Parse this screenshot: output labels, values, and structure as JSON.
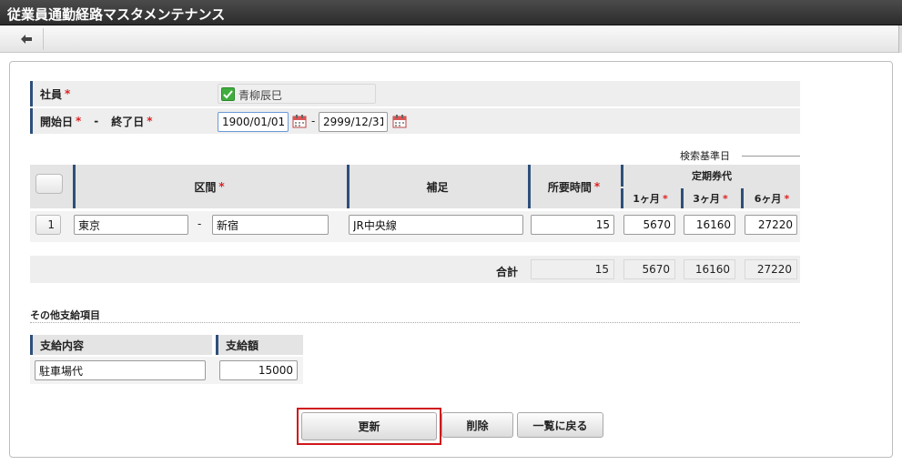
{
  "window": {
    "title": "従業員通勤経路マスタメンテナンス"
  },
  "toolbar": {
    "back_icon": "arrow-left-icon"
  },
  "employee": {
    "label": "社員",
    "required_mark": "*",
    "name": "青柳辰巳"
  },
  "period": {
    "start_label": "開始日",
    "separator": "-",
    "end_label": "終了日",
    "required_mark": "*",
    "start_value": "1900/01/01",
    "end_value": "2999/12/31",
    "range_separator": "-"
  },
  "search_base_date_label": "検索基準日",
  "route_table": {
    "headers": {
      "section": "区間",
      "note": "補足",
      "time": "所要時間",
      "commuter_pass": "定期券代",
      "one_month": "1ヶ月",
      "three_month": "3ヶ月",
      "six_month": "6ヶ月",
      "required_mark": "*"
    },
    "rows": [
      {
        "no": "1",
        "from": "東京",
        "separator": "-",
        "to": "新宿",
        "note": "JR中央線",
        "time": "15",
        "one_month": "5670",
        "three_month": "16160",
        "six_month": "27220"
      }
    ],
    "total": {
      "label": "合計",
      "time": "15",
      "one_month": "5670",
      "three_month": "16160",
      "six_month": "27220"
    }
  },
  "other_payments": {
    "title": "その他支給項目",
    "headers": {
      "content": "支給内容",
      "amount": "支給額"
    },
    "rows": [
      {
        "content": "駐車場代",
        "amount": "15000"
      }
    ]
  },
  "buttons": {
    "update": "更新",
    "delete": "削除",
    "back_to_list": "一覧に戻る"
  },
  "colors": {
    "required": "#dd2222",
    "highlight": "#d0161c",
    "header_accent": "#2e4f7a"
  }
}
